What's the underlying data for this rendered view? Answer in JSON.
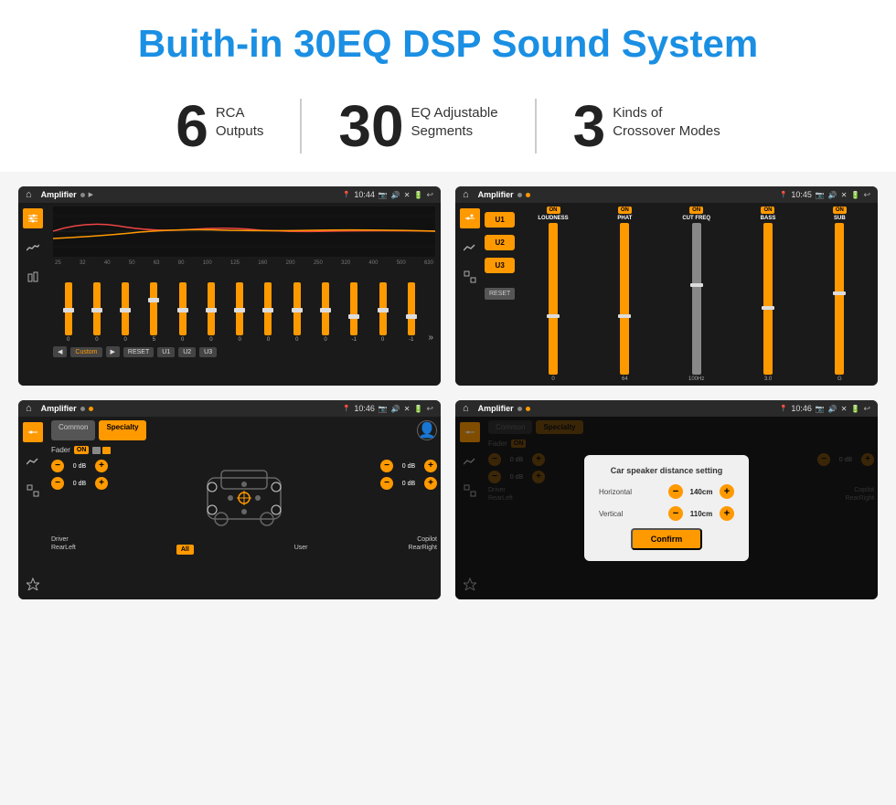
{
  "header": {
    "title": "Buith-in 30EQ DSP Sound System"
  },
  "stats": [
    {
      "number": "6",
      "label": "RCA\nOutputs"
    },
    {
      "number": "30",
      "label": "EQ Adjustable\nSegments"
    },
    {
      "number": "3",
      "label": "Kinds of\nCrossover Modes"
    }
  ],
  "screens": [
    {
      "id": "eq-screen",
      "status_title": "Amplifier",
      "status_time": "10:44",
      "type": "eq",
      "freq_labels": [
        "25",
        "32",
        "40",
        "50",
        "63",
        "80",
        "100",
        "125",
        "160",
        "200",
        "250",
        "320",
        "400",
        "500",
        "630"
      ],
      "slider_values": [
        "0",
        "0",
        "0",
        "5",
        "0",
        "0",
        "0",
        "0",
        "0",
        "0",
        "-1",
        "0",
        "-1"
      ],
      "eq_controls": [
        "◀",
        "Custom",
        "▶",
        "RESET",
        "U1",
        "U2",
        "U3"
      ]
    },
    {
      "id": "crossover-screen",
      "status_title": "Amplifier",
      "status_time": "10:45",
      "type": "crossover",
      "u_labels": [
        "U1",
        "U2",
        "U3"
      ],
      "columns": [
        {
          "label": "LOUDNESS",
          "on": true
        },
        {
          "label": "PHAT",
          "on": true
        },
        {
          "label": "CUT FREQ",
          "on": true
        },
        {
          "label": "BASS",
          "on": true
        },
        {
          "label": "SUB",
          "on": true
        }
      ]
    },
    {
      "id": "fader-screen",
      "status_title": "Amplifier",
      "status_time": "10:46",
      "type": "fader",
      "tabs": [
        "Common",
        "Specialty"
      ],
      "active_tab": "Specialty",
      "fader_label": "Fader",
      "fader_on": true,
      "controls": [
        {
          "label": "0 dB"
        },
        {
          "label": "0 dB"
        },
        {
          "label": "0 dB"
        },
        {
          "label": "0 dB"
        }
      ],
      "bottom_labels": [
        "Driver",
        "",
        "Copilot",
        "RearLeft",
        "All",
        "",
        "User",
        "RearRight"
      ]
    },
    {
      "id": "dialog-screen",
      "status_title": "Amplifier",
      "status_time": "10:46",
      "type": "dialog",
      "tabs": [
        "Common",
        "Specialty"
      ],
      "dialog": {
        "title": "Car speaker distance setting",
        "rows": [
          {
            "label": "Horizontal",
            "value": "140cm"
          },
          {
            "label": "Vertical",
            "value": "110cm"
          }
        ],
        "confirm_label": "Confirm"
      },
      "controls_right": [
        {
          "label": "0 dB"
        },
        {
          "label": "0 dB"
        }
      ]
    }
  ]
}
